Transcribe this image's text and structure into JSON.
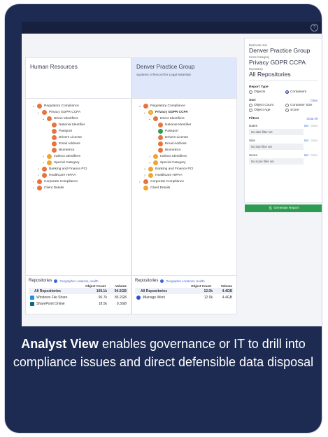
{
  "panels": {
    "left": {
      "title": "Human Resources",
      "subtitle": "",
      "tree": [
        {
          "label": "Regulatory Compliance",
          "depth": 1,
          "chev": "v",
          "color": "o",
          "bold": false
        },
        {
          "label": "Privacy GDPR CCPA",
          "depth": 2,
          "chev": "v",
          "color": "o",
          "bold": false
        },
        {
          "label": "Direct Identifiers",
          "depth": 3,
          "chev": "v",
          "color": "o",
          "bold": false
        },
        {
          "label": "National Identifier",
          "depth": 4,
          "chev": "",
          "color": "o",
          "bold": false
        },
        {
          "label": "Passport",
          "depth": 4,
          "chev": "",
          "color": "o",
          "bold": false
        },
        {
          "label": "Drivers License",
          "depth": 4,
          "chev": "",
          "color": "o",
          "bold": false
        },
        {
          "label": "Email Address",
          "depth": 4,
          "chev": "",
          "color": "o",
          "bold": false
        },
        {
          "label": "Biometrics",
          "depth": 4,
          "chev": "",
          "color": "o",
          "bold": false
        },
        {
          "label": "Indirect Identifiers",
          "depth": 3,
          "chev": ">",
          "color": "y",
          "bold": false
        },
        {
          "label": "Special Category",
          "depth": 3,
          "chev": ">",
          "color": "y",
          "bold": false
        },
        {
          "label": "Banking and Finance PCI",
          "depth": 2,
          "chev": ">",
          "color": "o",
          "bold": false
        },
        {
          "label": "Healthcare HIPAA",
          "depth": 2,
          "chev": ">",
          "color": "o",
          "bold": false
        },
        {
          "label": "Corporate Compliance",
          "depth": 1,
          "chev": ">",
          "color": "o",
          "bold": false
        },
        {
          "label": "Client Details",
          "depth": 1,
          "chev": ">",
          "color": "o",
          "bold": false
        }
      ],
      "repo": {
        "title": "Repositories",
        "filter": "Geographic Locations, Health",
        "col_count": "Object Count",
        "col_volume": "Volume",
        "rows": [
          {
            "name": "All Repositories",
            "count": "109.1k",
            "volume": "94.5GB",
            "icon": "",
            "all": true
          },
          {
            "name": "Windows File Share",
            "count": "90.7k",
            "volume": "85.2GB",
            "icon": "windows-icon",
            "all": false
          },
          {
            "name": "SharePoint Online",
            "count": "18.5k",
            "volume": "9.3GB",
            "icon": "sharepoint-icon",
            "all": false
          }
        ]
      }
    },
    "right": {
      "title": "Denver Practice Group",
      "subtitle": "Systems of Record for Legal Materials",
      "tree": [
        {
          "label": "Regulatory Compliance",
          "depth": 1,
          "chev": "v",
          "color": "o",
          "bold": false
        },
        {
          "label": "Privacy GDPR CCPA",
          "depth": 2,
          "chev": "v",
          "color": "badge",
          "bold": true,
          "badge": "3"
        },
        {
          "label": "Direct Identifiers",
          "depth": 3,
          "chev": "v",
          "color": "o",
          "bold": false
        },
        {
          "label": "National Identifier",
          "depth": 4,
          "chev": "",
          "color": "o",
          "bold": false
        },
        {
          "label": "Passport",
          "depth": 4,
          "chev": "",
          "color": "g",
          "bold": false
        },
        {
          "label": "Drivers License",
          "depth": 4,
          "chev": "",
          "color": "o",
          "bold": false
        },
        {
          "label": "Email Address",
          "depth": 4,
          "chev": "",
          "color": "o",
          "bold": false
        },
        {
          "label": "Biometrics",
          "depth": 4,
          "chev": "",
          "color": "o",
          "bold": false
        },
        {
          "label": "Indirect Identifiers",
          "depth": 3,
          "chev": ">",
          "color": "y",
          "bold": false
        },
        {
          "label": "Special Category",
          "depth": 3,
          "chev": ">",
          "color": "y",
          "bold": false
        },
        {
          "label": "Banking and Finance PCI",
          "depth": 2,
          "chev": ">",
          "color": "y",
          "bold": false
        },
        {
          "label": "Healthcare HIPAA",
          "depth": 2,
          "chev": ">",
          "color": "y",
          "bold": false
        },
        {
          "label": "Corporate Compliance",
          "depth": 1,
          "chev": ">",
          "color": "o",
          "bold": false
        },
        {
          "label": "Client Details",
          "depth": 1,
          "chev": "",
          "color": "y",
          "bold": false
        }
      ],
      "repo": {
        "title": "Repositories",
        "filter": "Geographic Locations, Health",
        "col_count": "Object Count",
        "col_volume": "Volume",
        "rows": [
          {
            "name": "All Repositories",
            "count": "12.0k",
            "volume": "4.4GB",
            "icon": "",
            "all": true
          },
          {
            "name": "iManage Work",
            "count": "12.0k",
            "volume": "4.4GB",
            "icon": "imanage-icon",
            "all": false
          }
        ]
      }
    }
  },
  "settings": {
    "business_unit_label": "Business Unit",
    "business_unit": "Denver Practice Group",
    "score_category_label": "Score Category",
    "score_category": "Privacy GDPR CCPA",
    "repository_label": "Repository",
    "repository": "All Repositories",
    "report_type_label": "Report Type",
    "report_type_options": [
      "Objects",
      "Containers"
    ],
    "report_type_selected": "Containers",
    "sort_label": "Sort",
    "sort_clear": "Clear",
    "sort_options": [
      "Object Count",
      "Container Size",
      "Object Age",
      "Score"
    ],
    "filters_label": "Filters",
    "filters_clear_all": "Clear All",
    "filters": [
      {
        "label": "Dates",
        "set": "Set",
        "clear": "Clear",
        "value": "No date filter set"
      },
      {
        "label": "Size",
        "set": "Set",
        "clear": "Clear",
        "value": "No size filter set"
      },
      {
        "label": "Score",
        "set": "Set",
        "clear": "Clear",
        "value": "No score filter set"
      }
    ],
    "generate_label": "Generate Report"
  },
  "caption": {
    "bold": "Analyst View",
    "rest": " enables governance or IT to drill into compliance issues and direct defensible data disposal"
  },
  "colors": {
    "orange": "#e7743f",
    "yellow": "#f0a431",
    "green": "#2e9b52",
    "navy": "#1d2a52"
  }
}
